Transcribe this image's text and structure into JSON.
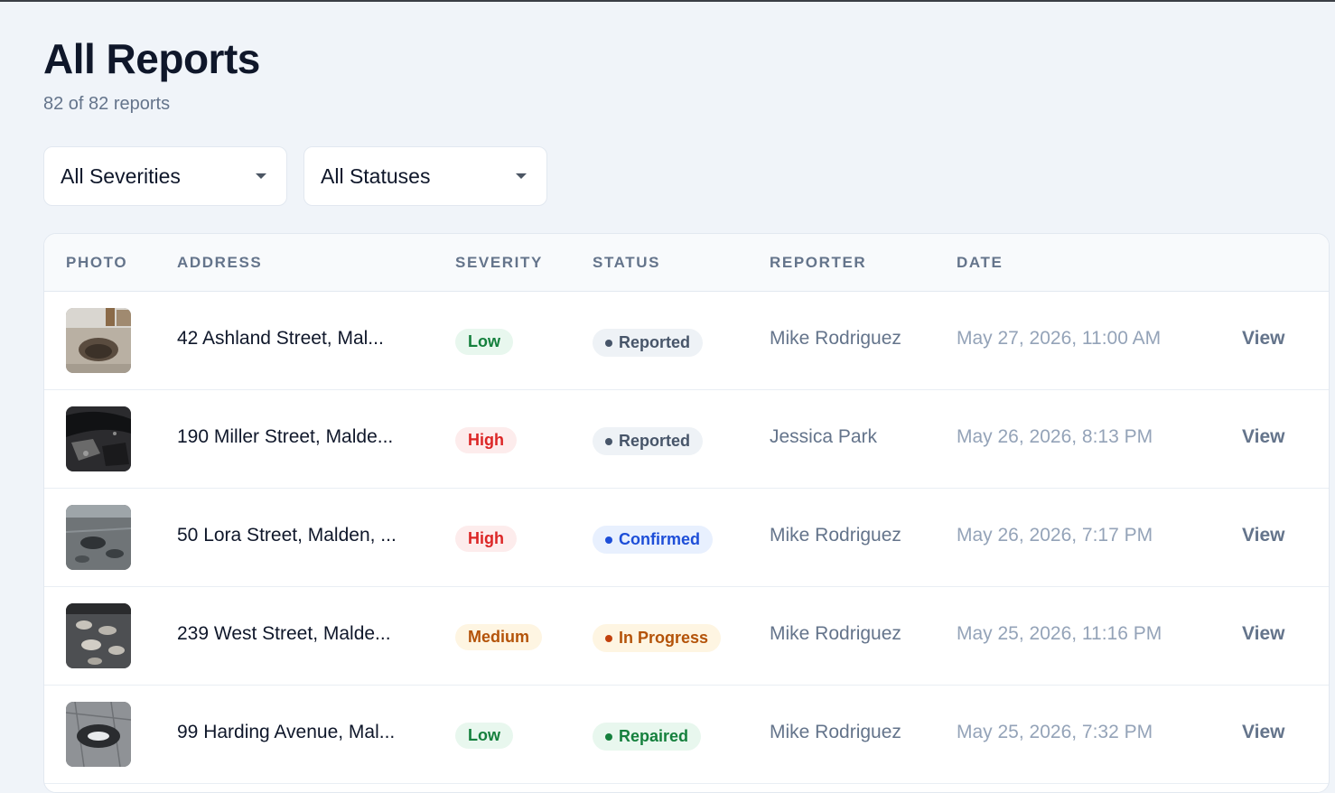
{
  "page": {
    "title": "All Reports",
    "subtitle": "82 of 82 reports"
  },
  "filters": {
    "severity": {
      "value": "All Severities",
      "icon": "chevron-down-icon"
    },
    "status": {
      "value": "All Statuses",
      "icon": "chevron-down-icon"
    }
  },
  "table": {
    "headers": {
      "photo": "PHOTO",
      "address": "ADDRESS",
      "severity": "SEVERITY",
      "status": "STATUS",
      "reporter": "REPORTER",
      "date": "DATE"
    },
    "rows": [
      {
        "address": "42 Ashland Street, Mal...",
        "severity": "Low",
        "status": "Reported",
        "reporter": "Mike Rodriguez",
        "date": "May 27, 2026, 11:00 AM",
        "action": "View"
      },
      {
        "address": "190 Miller Street, Malde...",
        "severity": "High",
        "status": "Reported",
        "reporter": "Jessica Park",
        "date": "May 26, 2026, 8:13 PM",
        "action": "View"
      },
      {
        "address": "50 Lora Street, Malden, ...",
        "severity": "High",
        "status": "Confirmed",
        "reporter": "Mike Rodriguez",
        "date": "May 26, 2026, 7:17 PM",
        "action": "View"
      },
      {
        "address": "239 West Street, Malde...",
        "severity": "Medium",
        "status": "In Progress",
        "reporter": "Mike Rodriguez",
        "date": "May 25, 2026, 11:16 PM",
        "action": "View"
      },
      {
        "address": "99 Harding Avenue, Mal...",
        "severity": "Low",
        "status": "Repaired",
        "reporter": "Mike Rodriguez",
        "date": "May 25, 2026, 7:32 PM",
        "action": "View"
      }
    ]
  },
  "colors": {
    "severity": {
      "Low": {
        "bg": "#e8f7ee",
        "fg": "#15803d"
      },
      "High": {
        "bg": "#fdecec",
        "fg": "#dc2626"
      },
      "Medium": {
        "bg": "#fef5e2",
        "fg": "#b45309"
      }
    },
    "status": {
      "Reported": {
        "bg": "#eef2f6",
        "fg": "#475569",
        "dot": "#475569"
      },
      "Confirmed": {
        "bg": "#e8f0fe",
        "fg": "#1d4ed8",
        "dot": "#1d4ed8"
      },
      "In Progress": {
        "bg": "#fef5e2",
        "fg": "#b45309",
        "dot": "#c2410c"
      },
      "Repaired": {
        "bg": "#e8f7ee",
        "fg": "#15803d",
        "dot": "#15803d"
      }
    }
  }
}
